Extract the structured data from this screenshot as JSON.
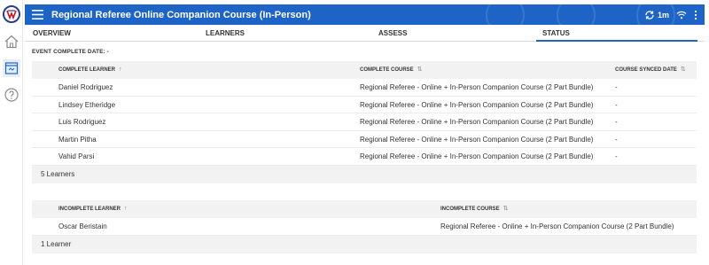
{
  "app": {
    "title": "Regional Referee Online Companion Course (In-Person)"
  },
  "topbar": {
    "sync_label": "1m"
  },
  "tabs": [
    {
      "label": "OVERVIEW"
    },
    {
      "label": "LEARNERS"
    },
    {
      "label": "ASSESS"
    },
    {
      "label": "STATUS"
    }
  ],
  "event": {
    "complete_date_label": "EVENT COMPLETE DATE: -"
  },
  "complete_table": {
    "headers": {
      "learner": "COMPLETE LEARNER",
      "course": "COMPLETE COURSE",
      "synced": "COURSE SYNCED DATE"
    },
    "rows": [
      {
        "learner": "Daniel Rodriguez",
        "course": "Regional Referee - Online + In-Person Companion Course (2 Part Bundle)",
        "synced": "-"
      },
      {
        "learner": "Lindsey Etheridge",
        "course": "Regional Referee - Online + In-Person Companion Course (2 Part Bundle)",
        "synced": "-"
      },
      {
        "learner": "Luis Rodriguez",
        "course": "Regional Referee - Online + In-Person Companion Course (2 Part Bundle)",
        "synced": "-"
      },
      {
        "learner": "Martin Pitha",
        "course": "Regional Referee - Online + In-Person Companion Course (2 Part Bundle)",
        "synced": "-"
      },
      {
        "learner": "Vahid Parsi",
        "course": "Regional Referee - Online + In-Person Companion Course (2 Part Bundle)",
        "synced": "-"
      }
    ],
    "footer": "5 Learners"
  },
  "incomplete_table": {
    "headers": {
      "learner": "INCOMPLETE LEARNER",
      "course": "INCOMPLETE COURSE"
    },
    "rows": [
      {
        "learner": "Oscar Beristain",
        "course": "Regional Referee - Online + In-Person Companion Course (2 Part Bundle)"
      }
    ],
    "footer": "1 Learner"
  },
  "icons": {
    "logo": "ussf-logo",
    "home": "home-icon",
    "course": "course-icon",
    "help": "help-icon",
    "menu": "hamburger-icon",
    "sync": "sync-icon",
    "wifi": "wifi-icon",
    "more": "kebab-icon"
  },
  "colors": {
    "accent": "#1d64c6"
  }
}
